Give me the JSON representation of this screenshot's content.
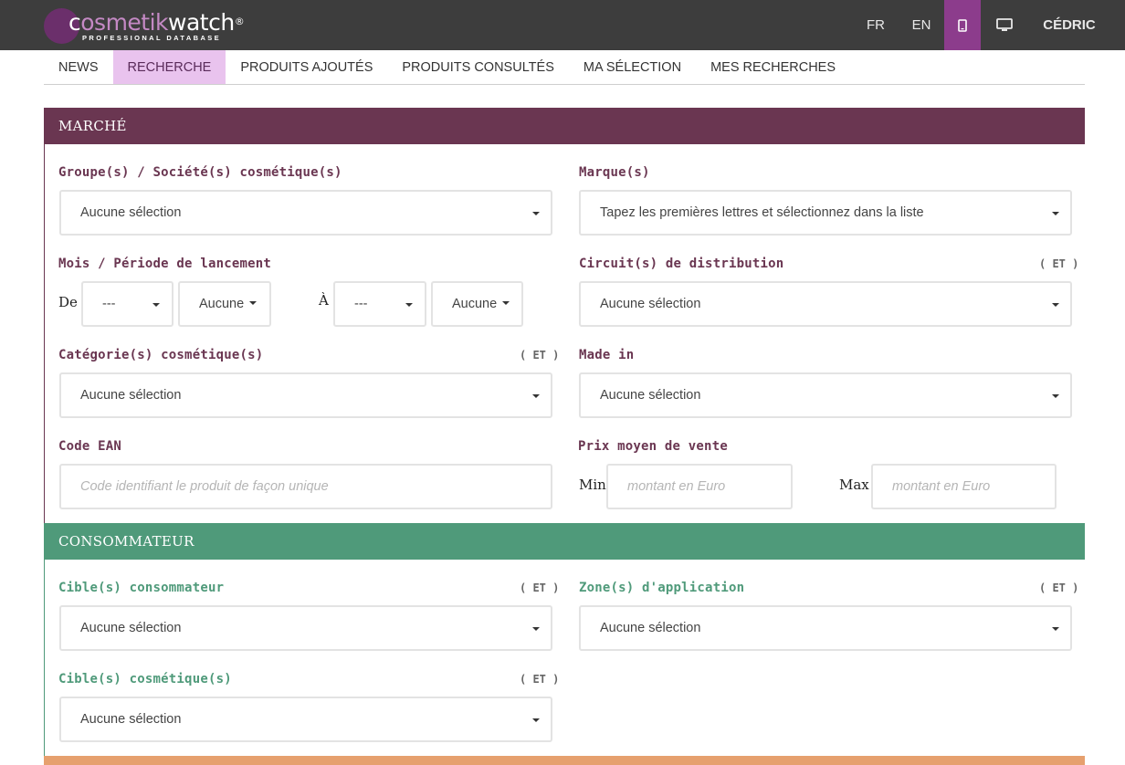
{
  "brand": {
    "logo_prefix": "c",
    "logo_accent": "osmetik",
    "logo_suffix": "watch",
    "logo_mark": "®",
    "tagline": "PROFESSIONAL DATABASE"
  },
  "topnav": {
    "fr": "FR",
    "en": "EN",
    "mobile_icon": "mobile-icon",
    "desktop_icon": "desktop-icon",
    "user": "CÉDRIC"
  },
  "tabs": [
    {
      "label": "NEWS"
    },
    {
      "label": "RECHERCHE",
      "active": true
    },
    {
      "label": "PRODUITS AJOUTÉS"
    },
    {
      "label": "PRODUITS CONSULTÉS"
    },
    {
      "label": "MA SÉLECTION"
    },
    {
      "label": "MES RECHERCHES"
    }
  ],
  "marche": {
    "title": "MARCHÉ",
    "groupes": {
      "label": "Groupe(s) / Société(s) cosmétique(s)",
      "value": "Aucune sélection"
    },
    "marques": {
      "label": "Marque(s)",
      "value": "Tapez les premières lettres et sélectionnez dans la liste"
    },
    "periode": {
      "label": "Mois / Période de lancement",
      "de": "De",
      "a": "À",
      "month_from": "---",
      "year_from": "Aucune",
      "month_to": "---",
      "year_to": "Aucune"
    },
    "circuits": {
      "label": "Circuit(s) de distribution",
      "et": "( ET )",
      "value": "Aucune sélection"
    },
    "categories": {
      "label": "Catégorie(s) cosmétique(s)",
      "et": "( ET )",
      "value": "Aucune sélection"
    },
    "made_in": {
      "label": "Made in",
      "value": "Aucune sélection"
    },
    "ean": {
      "label": "Code EAN",
      "placeholder": "Code identifiant le produit de façon unique"
    },
    "prix": {
      "label": "Prix moyen de vente",
      "min": "Min",
      "max": "Max",
      "min_placeholder": "montant en Euro",
      "max_placeholder": "montant en Euro"
    }
  },
  "consommateur": {
    "title": "CONSOMMATEUR",
    "cibles_conso": {
      "label": "Cible(s) consommateur",
      "et": "( ET )",
      "value": "Aucune sélection"
    },
    "zones": {
      "label": "Zone(s) d'application",
      "et": "( ET )",
      "value": "Aucune sélection"
    },
    "cibles_cosm": {
      "label": "Cible(s) cosmétique(s)",
      "et": "( ET )",
      "value": "Aucune sélection"
    }
  },
  "colors": {
    "marche": "#6a3651",
    "consommateur": "#4f9a7a",
    "active_tab": "#e9c3ee",
    "topbar": "#3d3d3d",
    "mobile_active": "#8c3c8c",
    "next_section": "#e6a06e"
  }
}
